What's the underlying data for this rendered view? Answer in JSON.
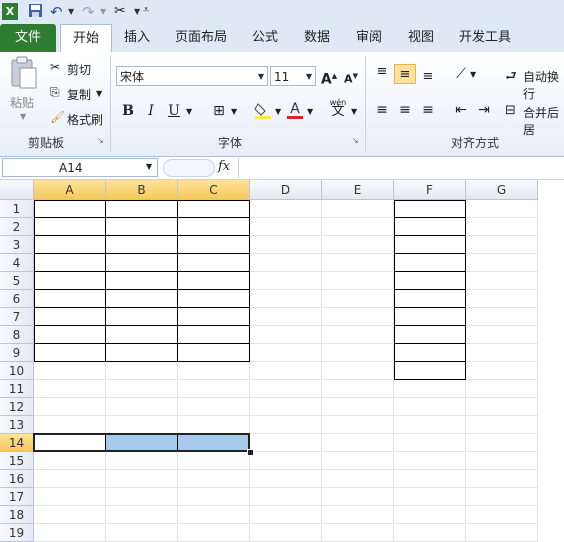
{
  "tabs": {
    "file": "文件",
    "home": "开始",
    "insert": "插入",
    "layout": "页面布局",
    "formula": "公式",
    "data": "数据",
    "review": "审阅",
    "view": "视图",
    "developer": "开发工具"
  },
  "clipboard": {
    "paste": "粘贴",
    "cut": "剪切",
    "copy": "复制",
    "format_painter": "格式刷",
    "label": "剪贴板"
  },
  "font": {
    "name": "宋体",
    "size": "11",
    "label": "字体",
    "bold": "B",
    "italic": "I",
    "underline": "U",
    "wen": "wén",
    "wen_char": "文"
  },
  "alignment": {
    "wrap": "自动换行",
    "merge": "合并后居",
    "label": "对齐方式"
  },
  "formula_bar": {
    "name_box": "A14",
    "fx": "fx"
  },
  "columns": [
    "A",
    "B",
    "C",
    "D",
    "E",
    "F",
    "G"
  ],
  "rows": [
    "1",
    "2",
    "3",
    "4",
    "5",
    "6",
    "7",
    "8",
    "9",
    "10",
    "11",
    "12",
    "13",
    "14",
    "15",
    "16",
    "17",
    "18",
    "19"
  ],
  "selected_cell": "A14",
  "colors": {
    "file_tab": "#2e7d32",
    "selection_fill": "#a6c9ec",
    "header_highlight": "#f6c85b"
  }
}
